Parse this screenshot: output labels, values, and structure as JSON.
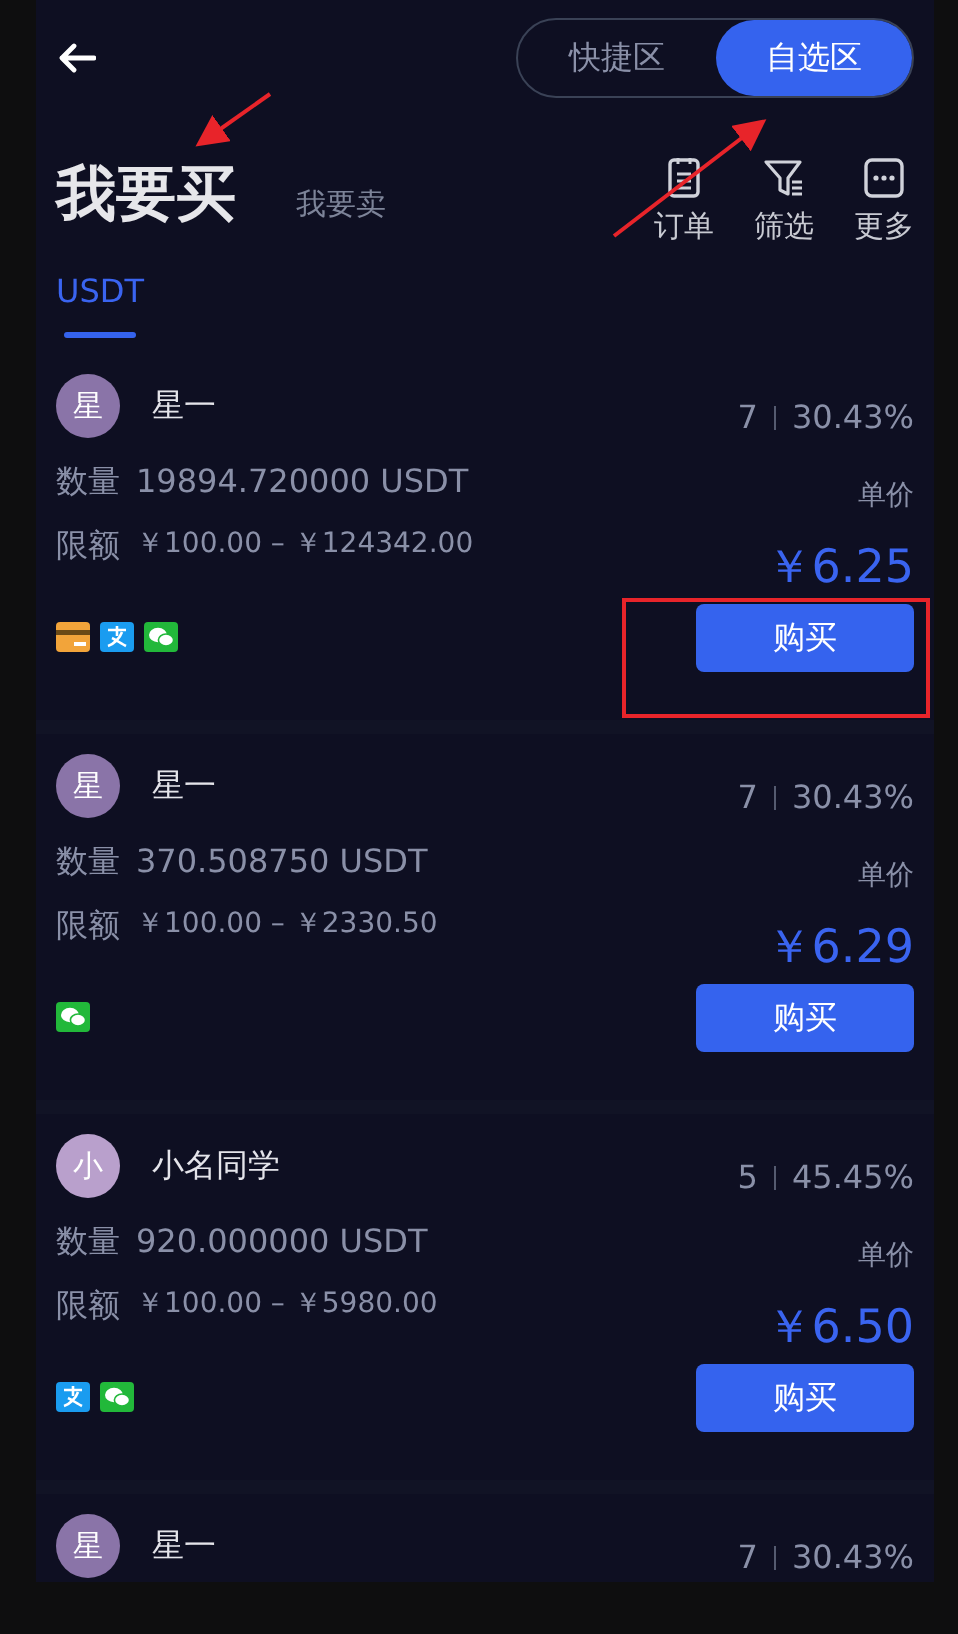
{
  "zones": [
    {
      "label": "快捷区",
      "selected": false
    },
    {
      "label": "自选区",
      "selected": true
    }
  ],
  "sides": [
    {
      "label": "我要买",
      "selected": true
    },
    {
      "label": "我要卖",
      "selected": false
    }
  ],
  "actions": [
    {
      "kind": "orders",
      "label": "订单"
    },
    {
      "kind": "filter",
      "label": "筛选"
    },
    {
      "kind": "more",
      "label": "更多"
    }
  ],
  "currencies": [
    {
      "label": "USDT",
      "selected": true
    }
  ],
  "offers": [
    {
      "avatar": "星",
      "color": "#8a74a8",
      "name": "星一",
      "trades": "7",
      "rate": "30.43%",
      "qty_label": "数量",
      "qty": "19894.720000 USDT",
      "limit_label": "限额",
      "limit": "￥100.00 – ￥124342.00",
      "price_label": "单价",
      "price": "￥6.25",
      "payments": [
        {
          "kind": "card"
        },
        {
          "kind": "alipay"
        },
        {
          "kind": "wechat"
        }
      ],
      "button": "购买"
    },
    {
      "avatar": "星",
      "color": "#8a74a8",
      "name": "星一",
      "trades": "7",
      "rate": "30.43%",
      "qty_label": "数量",
      "qty": "370.508750 USDT",
      "limit_label": "限额",
      "limit": "￥100.00 – ￥2330.50",
      "price_label": "单价",
      "price": "￥6.29",
      "payments": [
        {
          "kind": "wechat"
        }
      ],
      "button": "购买"
    },
    {
      "avatar": "小",
      "color": "#b9a0cc",
      "name": "小名同学",
      "trades": "5",
      "rate": "45.45%",
      "qty_label": "数量",
      "qty": "920.000000 USDT",
      "limit_label": "限额",
      "limit": "￥100.00 – ￥5980.00",
      "price_label": "单价",
      "price": "￥6.50",
      "payments": [
        {
          "kind": "alipay"
        },
        {
          "kind": "wechat"
        }
      ],
      "button": "购买"
    },
    {
      "avatar": "星",
      "color": "#8a74a8",
      "name": "星一",
      "trades": "7",
      "rate": "30.43%"
    }
  ]
}
